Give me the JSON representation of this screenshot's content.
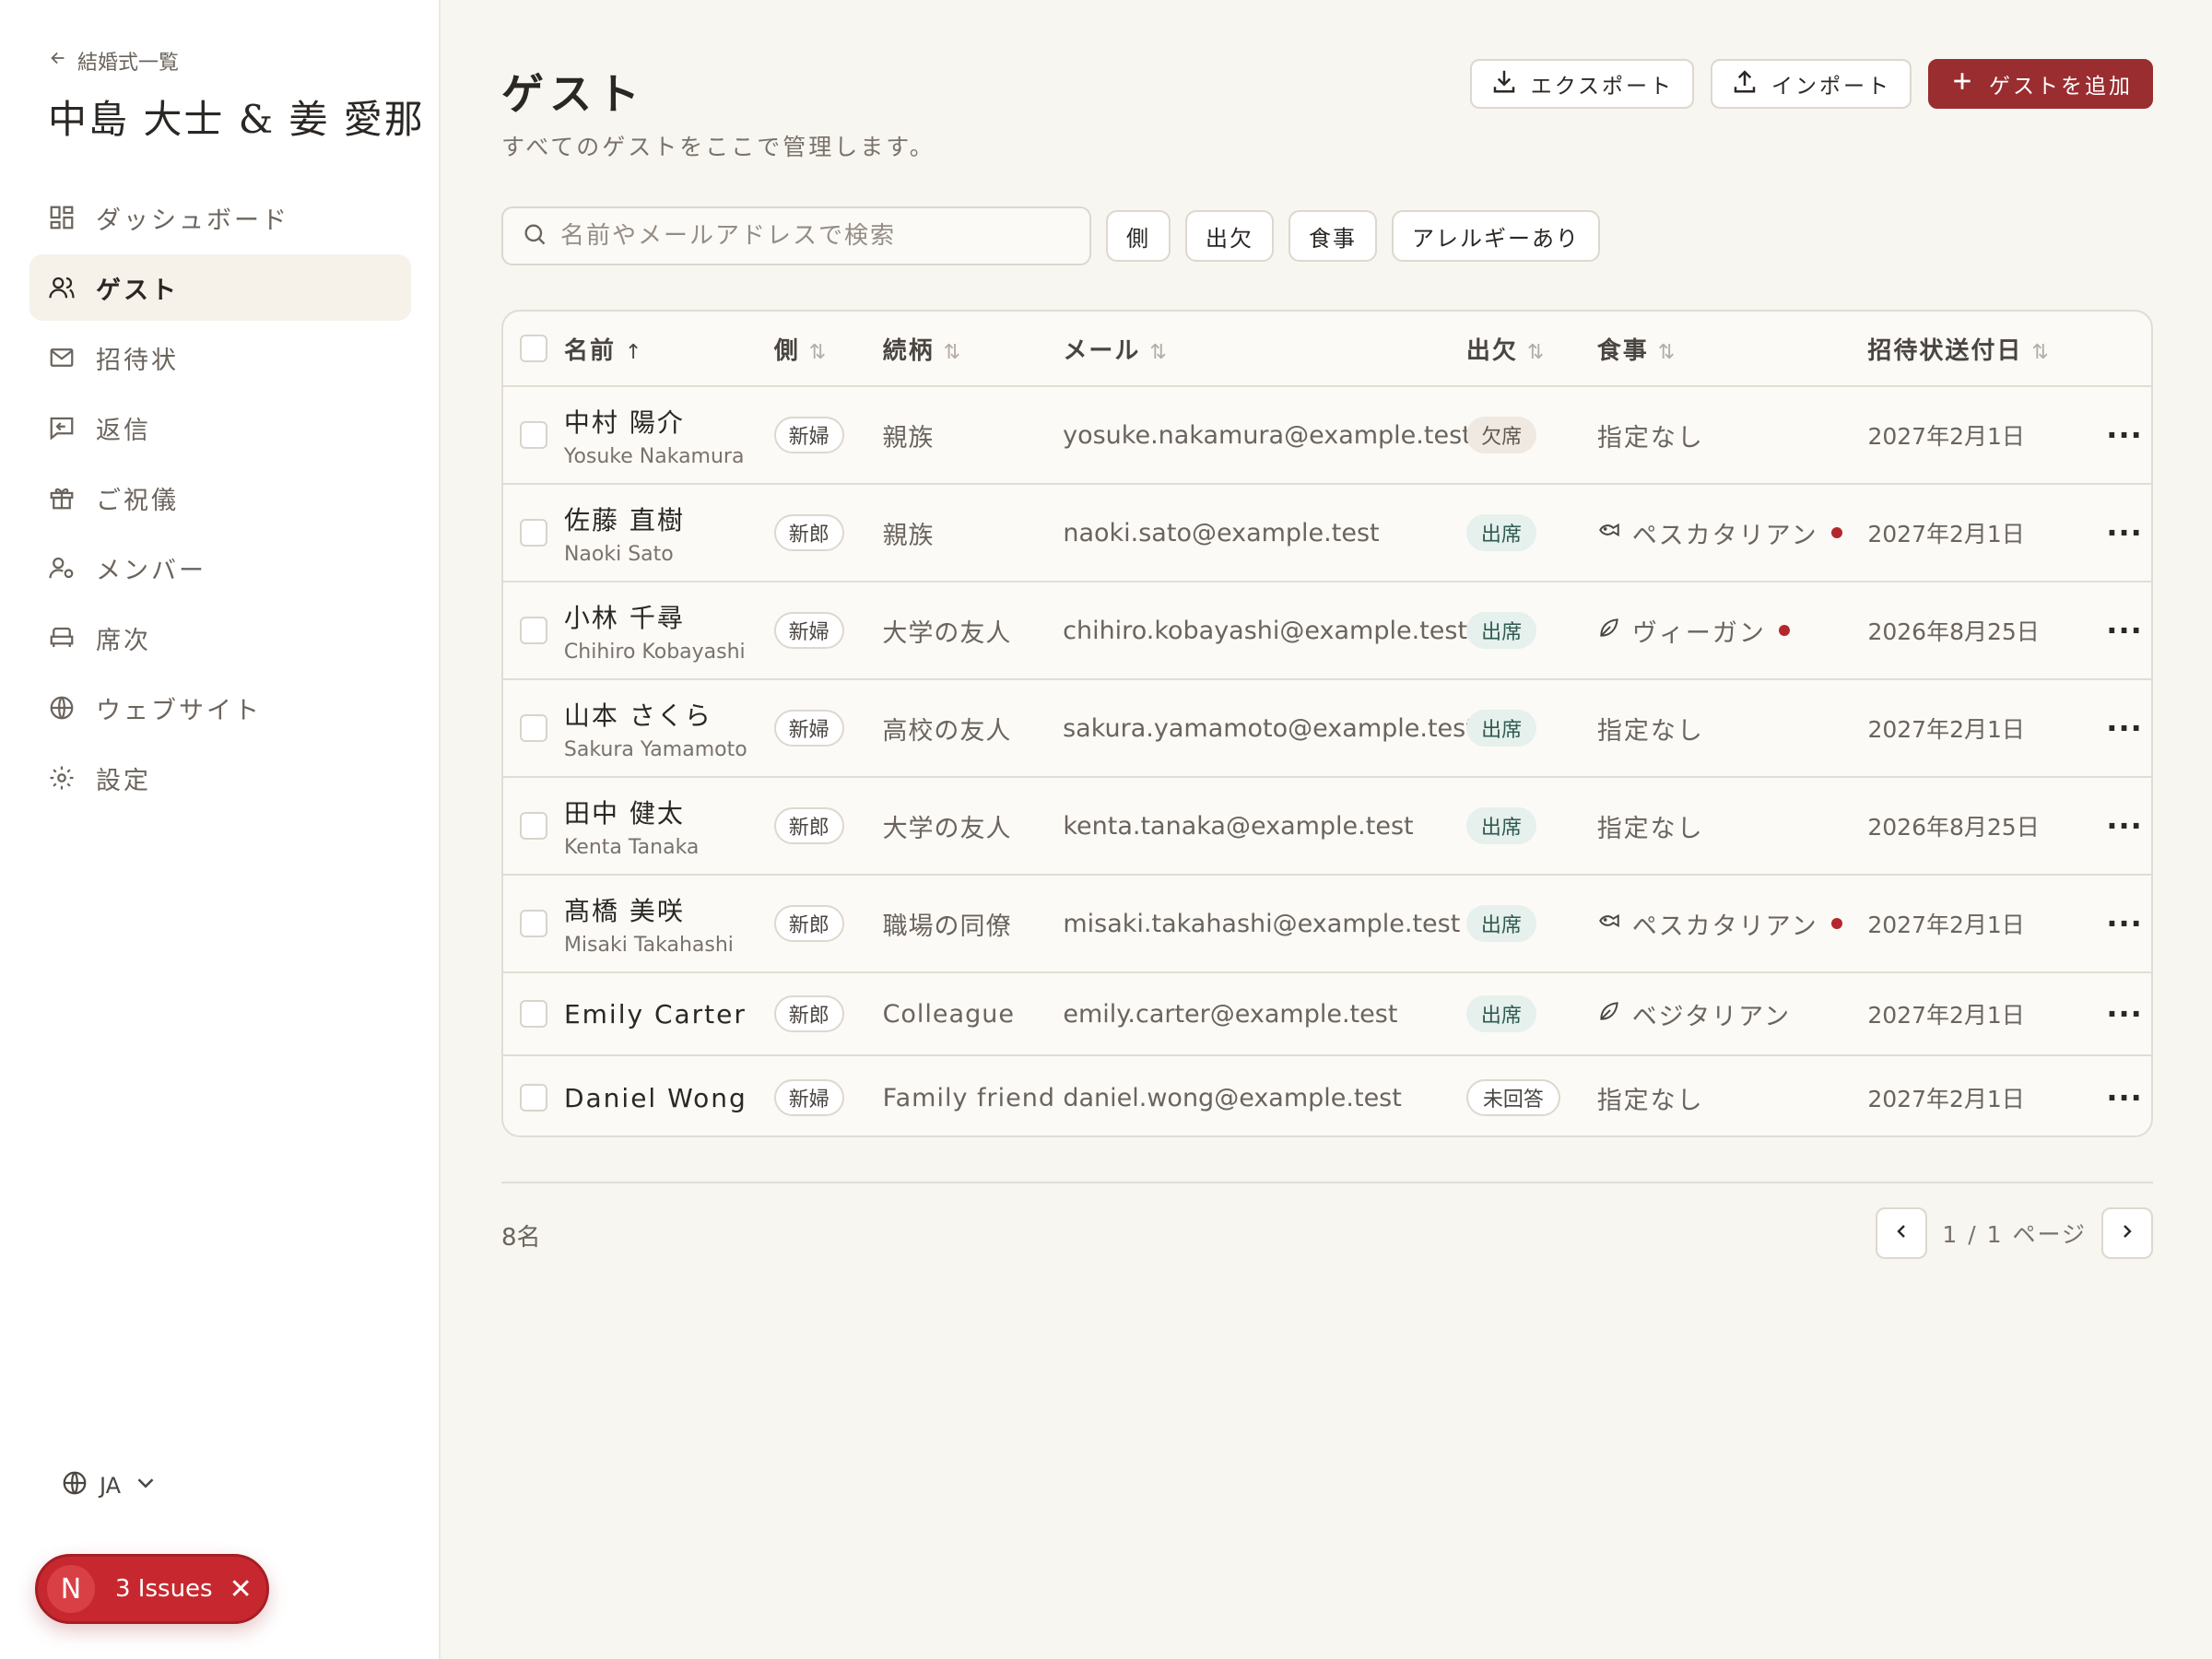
{
  "sidebar": {
    "back_label": "結婚式一覧",
    "couple_name": "中島 大士 & 姜 愛那",
    "nav": [
      {
        "label": "ダッシュボード",
        "icon": "dashboard-icon",
        "active": false
      },
      {
        "label": "ゲスト",
        "icon": "users-icon",
        "active": true
      },
      {
        "label": "招待状",
        "icon": "mail-icon",
        "active": false
      },
      {
        "label": "返信",
        "icon": "reply-icon",
        "active": false
      },
      {
        "label": "ご祝儀",
        "icon": "gift-icon",
        "active": false
      },
      {
        "label": "メンバー",
        "icon": "member-settings-icon",
        "active": false
      },
      {
        "label": "席次",
        "icon": "seat-icon",
        "active": false
      },
      {
        "label": "ウェブサイト",
        "icon": "globe-icon",
        "active": false
      },
      {
        "label": "設定",
        "icon": "gear-icon",
        "active": false
      }
    ],
    "language": "JA",
    "issues_badge": {
      "logo": "N",
      "label": "3 Issues"
    }
  },
  "header": {
    "title": "ゲスト",
    "subtitle": "すべてのゲストをここで管理します。",
    "export_label": "エクスポート",
    "import_label": "インポート",
    "add_label": "ゲストを追加"
  },
  "search": {
    "placeholder": "名前やメールアドレスで検索",
    "value": ""
  },
  "filters": [
    "側",
    "出欠",
    "食事",
    "アレルギーあり"
  ],
  "table": {
    "columns": {
      "name": "名前",
      "side": "側",
      "relationship": "続柄",
      "email": "メール",
      "attendance": "出欠",
      "meal": "食事",
      "sent_date": "招待状送付日"
    },
    "rows": [
      {
        "name_ja": "中村 陽介",
        "name_en": "Yosuke Nakamura",
        "side": "新婦",
        "relationship": "親族",
        "email": "yosuke.nakamura@example.test",
        "attendance": "欠席",
        "meal": "指定なし",
        "sent_date": "2027年2月1日"
      },
      {
        "name_ja": "佐藤 直樹",
        "name_en": "Naoki Sato",
        "side": "新郎",
        "relationship": "親族",
        "email": "naoki.sato@example.test",
        "attendance": "出席",
        "meal": "ペスカタリアン",
        "sent_date": "2027年2月1日"
      },
      {
        "name_ja": "小林 千尋",
        "name_en": "Chihiro Kobayashi",
        "side": "新婦",
        "relationship": "大学の友人",
        "email": "chihiro.kobayashi@example.test",
        "attendance": "出席",
        "meal": "ヴィーガン",
        "sent_date": "2026年8月25日"
      },
      {
        "name_ja": "山本 さくら",
        "name_en": "Sakura Yamamoto",
        "side": "新婦",
        "relationship": "高校の友人",
        "email": "sakura.yamamoto@example.test",
        "attendance": "出席",
        "meal": "指定なし",
        "sent_date": "2027年2月1日"
      },
      {
        "name_ja": "田中 健太",
        "name_en": "Kenta Tanaka",
        "side": "新郎",
        "relationship": "大学の友人",
        "email": "kenta.tanaka@example.test",
        "attendance": "出席",
        "meal": "指定なし",
        "sent_date": "2026年8月25日"
      },
      {
        "name_ja": "髙橋 美咲",
        "name_en": "Misaki Takahashi",
        "side": "新郎",
        "relationship": "職場の同僚",
        "email": "misaki.takahashi@example.test",
        "attendance": "出席",
        "meal": "ペスカタリアン",
        "sent_date": "2027年2月1日"
      },
      {
        "name_ja": "Emily Carter",
        "name_en": "",
        "side": "新郎",
        "relationship": "Colleague",
        "email": "emily.carter@example.test",
        "attendance": "出席",
        "meal": "ベジタリアン",
        "sent_date": "2027年2月1日"
      },
      {
        "name_ja": "Daniel Wong",
        "name_en": "",
        "side": "新婦",
        "relationship": "Family friend",
        "email": "daniel.wong@example.test",
        "attendance": "未回答",
        "meal": "指定なし",
        "sent_date": "2027年2月1日"
      }
    ]
  },
  "footer": {
    "count": "8名",
    "page_label": "1 / 1 ページ"
  },
  "colors": {
    "accent": "#9a2d30",
    "attending_bg": "#e6f0ec",
    "allergy_dot": "#b4272d",
    "background": "#f8f6f1"
  }
}
